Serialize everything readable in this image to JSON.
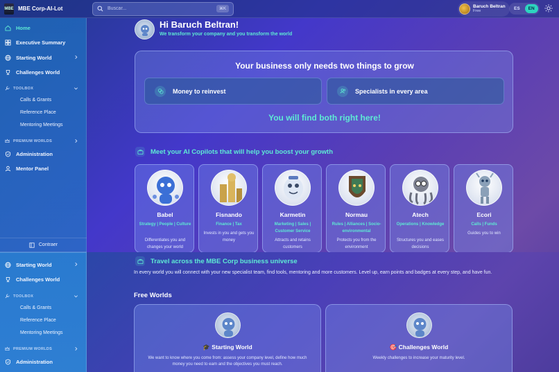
{
  "app": {
    "name": "MBE Corp-AI-Lot",
    "logo_text": "MBE"
  },
  "search": {
    "placeholder": "Buscar...",
    "shortcut": "⌘K"
  },
  "user": {
    "name": "Baruch Beltran",
    "plan": "Free"
  },
  "languages": [
    "ES",
    "EN"
  ],
  "active_language": "EN",
  "sidebar": {
    "items": [
      {
        "label": "Home",
        "icon": "home-icon"
      },
      {
        "label": "Executive Summary",
        "icon": "summary-icon"
      },
      {
        "label": "Starting World",
        "icon": "globe-icon"
      },
      {
        "label": "Challenges World",
        "icon": "trophy-icon"
      },
      {
        "label": "Administration",
        "icon": "shield-icon"
      },
      {
        "label": "Mentor Panel",
        "icon": "user-icon"
      }
    ],
    "toolbox_label": "TOOLBOX",
    "toolbox_items": [
      "Calls & Grants",
      "Reference Place",
      "Mentoring Meetings"
    ],
    "premium_label": "PREMIUM WORLDS",
    "collapse_label": "Contraer"
  },
  "hero": {
    "title": "Hi Baruch Beltran!",
    "subtitle": "We transform your company and you transform the world"
  },
  "grow": {
    "title": "Your business only needs two things to grow",
    "box1": "Money to reinvest",
    "box2": "Specialists in every area",
    "cta": "You will find both right here!"
  },
  "copilots_heading": "Meet your AI Copilots that will help you boost your growth",
  "copilots": [
    {
      "name": "Babel",
      "tags": "Strategy | People | Culture",
      "desc": "Differentiates you and changes your world",
      "color": "#3b6fd6"
    },
    {
      "name": "Fisnando",
      "tags": "Finance | Tax",
      "desc": "Invests in you and gets you money",
      "color": "#c9a24a"
    },
    {
      "name": "Karmetin",
      "tags": "Marketing | Sales | Customer Service",
      "desc": "Attracts and retains customers",
      "color": "#9fb8e0"
    },
    {
      "name": "Normau",
      "tags": "Rules | Alliances | Socio-environmental",
      "desc": "Protects you from the environment",
      "color": "#6b4a2e"
    },
    {
      "name": "Atech",
      "tags": "Operations | Knowledge",
      "desc": "Structures you and eases decisions",
      "color": "#7c8090"
    },
    {
      "name": "Ecori",
      "tags": "Calls | Funds",
      "desc": "Guides you to win",
      "color": "#8aa0b8"
    }
  ],
  "travel": {
    "heading": "Travel across the MBE Corp business universe",
    "text": "In every world you will connect with your new specialist team, find tools, mentoring and more customers. Level up, earn points and badges at every step, and have fun."
  },
  "free_worlds_title": "Free Worlds",
  "worlds": [
    {
      "title": "Starting World",
      "emoji": "🎓",
      "desc": "We want to know where you come from: assess your company level, define how much money you need to earn and the objectives you must reach."
    },
    {
      "title": "Challenges World",
      "emoji": "🎯",
      "desc": "Weekly challenges to increase your maturity level."
    }
  ],
  "overlay_sidebar": {
    "items": [
      "Starting World",
      "Challenges World",
      "Administration"
    ],
    "toolbox_label": "TOOLBOX",
    "toolbox_items": [
      "Calls & Grants",
      "Reference Place",
      "Mentoring Meetings"
    ],
    "premium_label": "PREMIUM WORLDS"
  }
}
